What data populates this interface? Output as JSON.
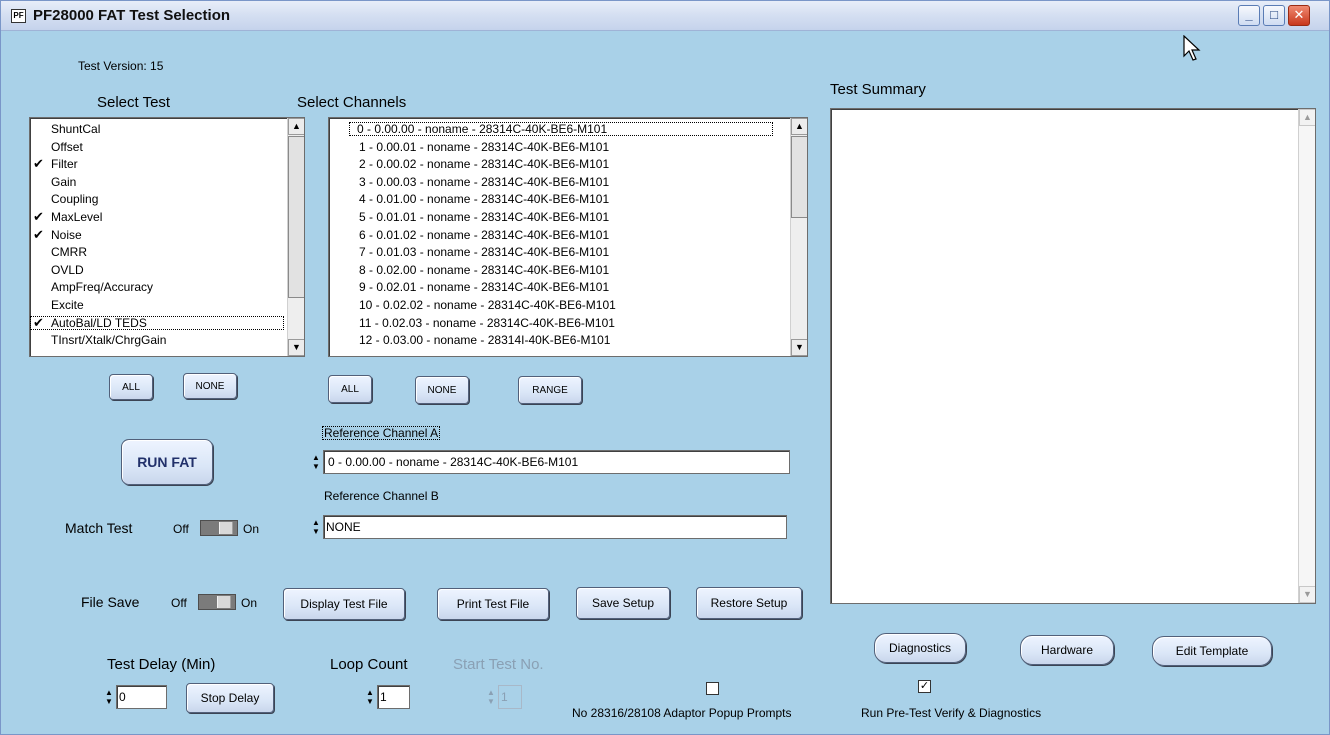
{
  "window": {
    "title": "PF28000 FAT Test Selection",
    "icon_text": "PF",
    "controls": {
      "minimize": "_",
      "maximize": "□",
      "close": "✕"
    }
  },
  "test_version": "Test Version: 15",
  "select_test": {
    "label": "Select Test",
    "items": [
      {
        "label": "ShuntCal",
        "checked": false
      },
      {
        "label": "Offset",
        "checked": false
      },
      {
        "label": "Filter",
        "checked": true
      },
      {
        "label": "Gain",
        "checked": false
      },
      {
        "label": "Coupling",
        "checked": false
      },
      {
        "label": "MaxLevel",
        "checked": true
      },
      {
        "label": "Noise",
        "checked": true
      },
      {
        "label": "CMRR",
        "checked": false
      },
      {
        "label": "OVLD",
        "checked": false
      },
      {
        "label": "AmpFreq/Accuracy",
        "checked": false
      },
      {
        "label": "Excite",
        "checked": false
      },
      {
        "label": "AutoBal/LD TEDS",
        "checked": true
      },
      {
        "label": "TInsrt/Xtalk/ChrgGain",
        "checked": false
      }
    ],
    "all_label": "ALL",
    "none_label": "NONE"
  },
  "select_channels": {
    "label": "Select Channels",
    "items": [
      "0 - 0.00.00 - noname - 28314C-40K-BE6-M101",
      "1 - 0.00.01 - noname - 28314C-40K-BE6-M101",
      "2 - 0.00.02 - noname - 28314C-40K-BE6-M101",
      "3 - 0.00.03 - noname - 28314C-40K-BE6-M101",
      "4 - 0.01.00 - noname - 28314C-40K-BE6-M101",
      "5 - 0.01.01 - noname - 28314C-40K-BE6-M101",
      "6 - 0.01.02 - noname - 28314C-40K-BE6-M101",
      "7 - 0.01.03 - noname - 28314C-40K-BE6-M101",
      "8 - 0.02.00 - noname - 28314C-40K-BE6-M101",
      "9 - 0.02.01 - noname - 28314C-40K-BE6-M101",
      "10 - 0.02.02 - noname - 28314C-40K-BE6-M101",
      "11 - 0.02.03 - noname - 28314C-40K-BE6-M101",
      "12 - 0.03.00 - noname - 28314I-40K-BE6-M101"
    ],
    "all_label": "ALL",
    "none_label": "NONE",
    "range_label": "RANGE"
  },
  "run_fat_label": "RUN FAT",
  "reference_a": {
    "label": "Reference Channel A",
    "value": "0 - 0.00.00 - noname - 28314C-40K-BE6-M101"
  },
  "reference_b": {
    "label": "Reference Channel B",
    "value": "NONE"
  },
  "match_test": {
    "label": "Match Test",
    "off": "Off",
    "on": "On",
    "state": "off"
  },
  "file_save": {
    "label": "File Save",
    "off": "Off",
    "on": "On",
    "state": "off"
  },
  "buttons": {
    "display_test_file": "Display Test File",
    "print_test_file": "Print Test File",
    "save_setup": "Save Setup",
    "restore_setup": "Restore Setup",
    "diagnostics": "Diagnostics",
    "hardware": "Hardware",
    "edit_template": "Edit Template",
    "stop_delay": "Stop Delay"
  },
  "test_summary": {
    "label": "Test Summary",
    "text": ""
  },
  "test_delay": {
    "label": "Test Delay (Min)",
    "value": "0"
  },
  "loop_count": {
    "label": "Loop Count",
    "value": "1"
  },
  "start_test": {
    "label": "Start Test No.",
    "value": "1",
    "enabled": false
  },
  "no_adaptor_popup": {
    "label": "No 28316/28108 Adaptor Popup Prompts",
    "checked": false
  },
  "run_pretest": {
    "label": "Run Pre-Test Verify & Diagnostics",
    "checked": true
  }
}
